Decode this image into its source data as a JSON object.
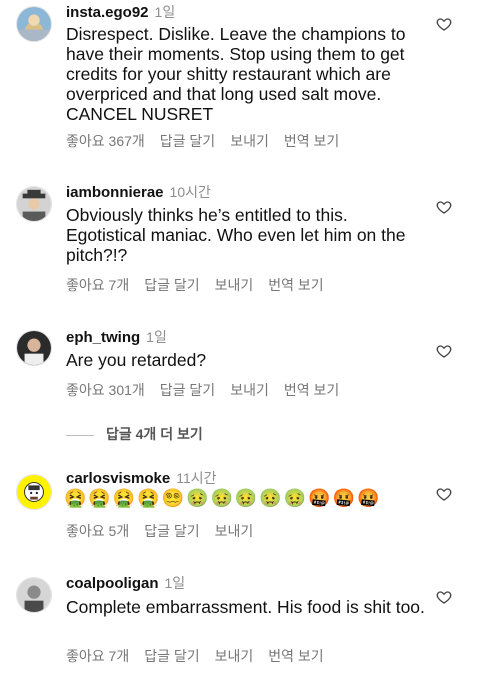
{
  "comments": [
    {
      "username": "insta.ego92",
      "time": "1일",
      "text": "Disrespect. Dislike. Leave the champions to have their moments. Stop using them to get credits for your shitty restaurant which are overpriced and that long used salt move. CANCEL NUSRET",
      "likes": "좋아요 367개",
      "reply": "답글 달기",
      "send": "보내기",
      "translate": "번역 보기"
    },
    {
      "username": "iambonnierae",
      "time": "10시간",
      "text": "Obviously thinks he’s entitled to this. Egotistical maniac. Who even let him on the pitch?!?",
      "likes": "좋아요 7개",
      "reply": "답글 달기",
      "send": "보내기",
      "translate": "번역 보기"
    },
    {
      "username": "eph_twing",
      "time": "1일",
      "text": "Are you retarded?",
      "likes": "좋아요 301개",
      "reply": "답글 달기",
      "send": "보내기",
      "translate": "번역 보기",
      "view_replies": "답글 4개 더 보기"
    },
    {
      "username": "carlosvismoke",
      "time": "11시간",
      "text": "🤮🤮🤮🤮😵‍💫🤢🤢🤢🤢🤢🤬🤬🤬",
      "likes": "좋아요 5개",
      "reply": "답글 달기",
      "send": "보내기"
    },
    {
      "username": "coalpooligan",
      "time": "1일",
      "text": "Complete embarrassment. His food is shit too.",
      "likes": "좋아요 7개",
      "reply": "답글 달기",
      "send": "보내기",
      "translate": "번역 보기"
    }
  ],
  "icons": {
    "like": "heart-outline-icon",
    "reply_divider": "reply-thread-line"
  },
  "colors": {
    "text": "#111111",
    "secondary": "#8e8e8e",
    "divider": "#bdbdbd"
  }
}
